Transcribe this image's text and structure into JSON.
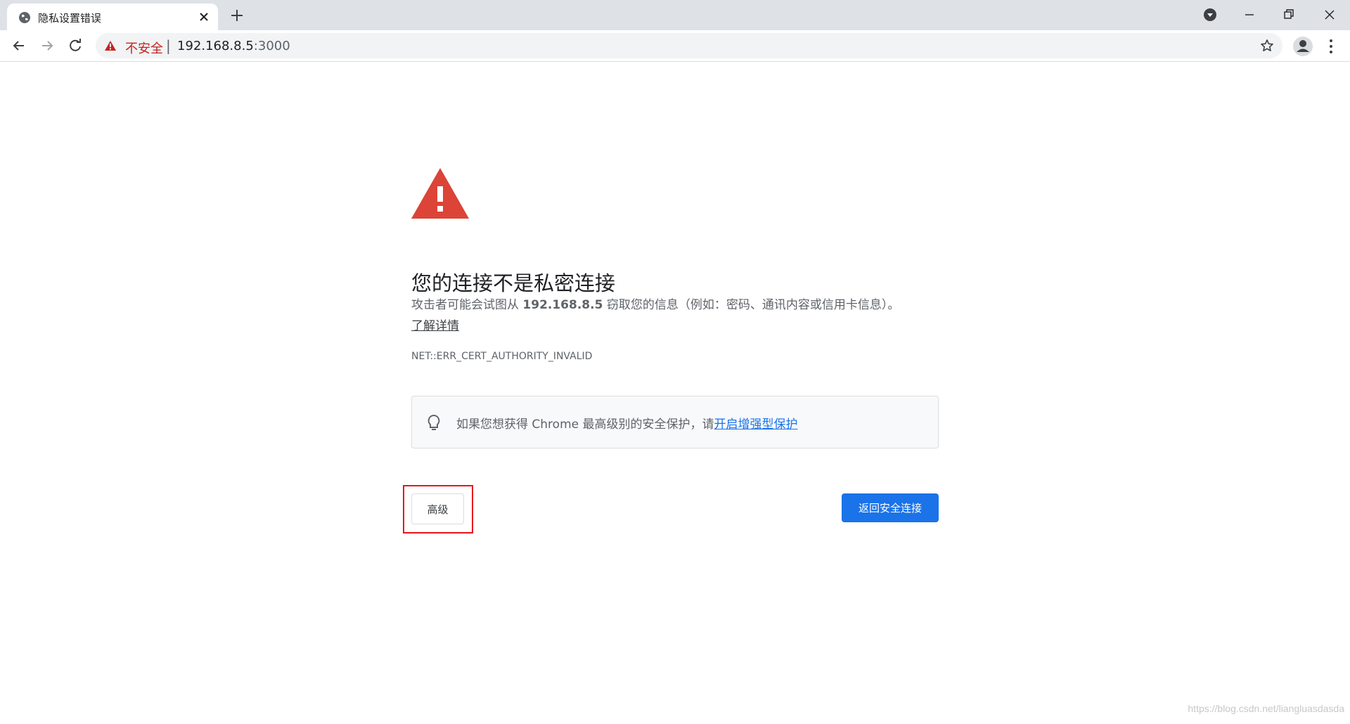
{
  "tab": {
    "title": "隐私设置错误",
    "favicon": "globe-icon",
    "close_icon": "close-icon"
  },
  "toolbar": {
    "insecure_label": "不安全",
    "separator": "|",
    "url_host": "192.168.8.5",
    "url_port": ":3000"
  },
  "interstitial": {
    "heading": "您的连接不是私密连接",
    "desc_prefix": "攻击者可能会试图从 ",
    "desc_host": "192.168.8.5",
    "desc_suffix": " 窃取您的信息（例如：密码、通讯内容或信用卡信息）。",
    "learn_more": "了解详情",
    "error_code": "NET::ERR_CERT_AUTHORITY_INVALID",
    "tip_text": "如果您想获得 Chrome 最高级别的安全保护，请",
    "tip_link": "开启增强型保护",
    "advanced_button": "高级",
    "back_button": "返回安全连接"
  },
  "watermark": "https://blog.csdn.net/liangluasdasda",
  "colors": {
    "tabstrip_bg": "#dee1e6",
    "insecure_red": "#c5221f",
    "warning_red": "#db4437",
    "primary_blue": "#1a73e8",
    "highlight_red": "#e8141b"
  }
}
